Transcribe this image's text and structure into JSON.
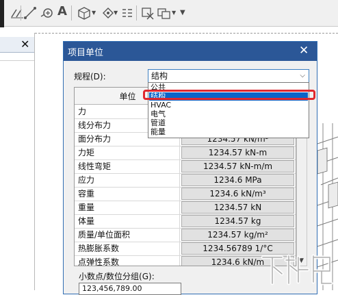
{
  "dialog": {
    "title": "项目单位",
    "close_glyph": "✕",
    "discipline_label": "规程(D):",
    "discipline_value": "结构",
    "dropdown_options": [
      "公共",
      "结构",
      "HVAC",
      "电气",
      "管道",
      "能量"
    ],
    "selected_option": "结构",
    "table_header_unit": "单位",
    "rows": [
      {
        "name": "力",
        "value": ""
      },
      {
        "name": "线分布力",
        "value": ""
      },
      {
        "name": "面分布力",
        "value": "1234.57 kN/m²"
      },
      {
        "name": "力矩",
        "value": "1234.57 kN-m"
      },
      {
        "name": "线性弯矩",
        "value": "1234.57 kN-m/m"
      },
      {
        "name": "应力",
        "value": "1234.6 MPa"
      },
      {
        "name": "容重",
        "value": "1234.6 kN/m³"
      },
      {
        "name": "重量",
        "value": "1234.57 kN"
      },
      {
        "name": "体量",
        "value": "1234.57 kg"
      },
      {
        "name": "质量/单位面积",
        "value": "1234.57 kg/m²"
      },
      {
        "name": "热膨胀系数",
        "value": "1234.56789 1/°C"
      },
      {
        "name": "点弹性系数",
        "value": "1234.6 kN/m"
      }
    ],
    "decimal_label": "小数点/数位分组(G):",
    "decimal_value": "123,456,789.00"
  },
  "left_panel": {
    "close_glyph": "✕"
  },
  "toolbar": {
    "text_tool_glyph": "A"
  },
  "watermark": {
    "text": "下载吧"
  },
  "colors": {
    "title_bar": "#2b5797",
    "selection": "#0a64c8",
    "highlight_box": "#e0282e"
  }
}
